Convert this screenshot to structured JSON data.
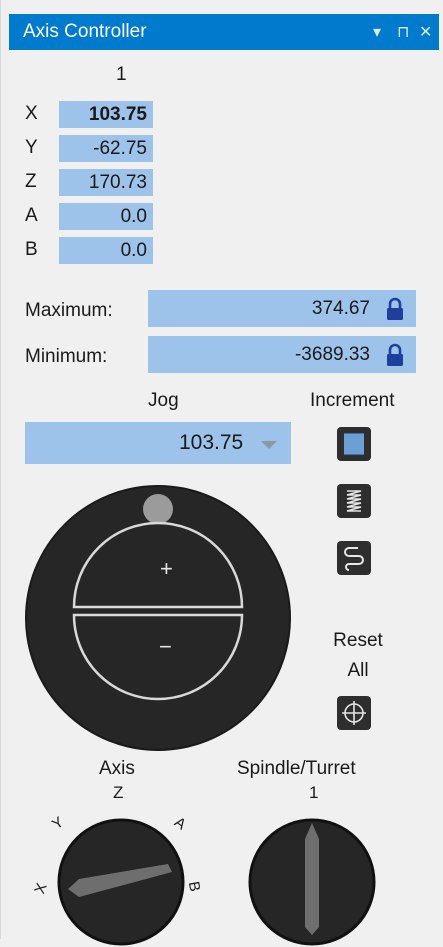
{
  "window": {
    "title": "Axis Controller",
    "controls": [
      "▾",
      "⊓",
      "✕"
    ]
  },
  "positions": {
    "column_header": "1",
    "rows": [
      {
        "axis": "X",
        "value": "103.75"
      },
      {
        "axis": "Y",
        "value": "-62.75"
      },
      {
        "axis": "Z",
        "value": "170.73"
      },
      {
        "axis": "A",
        "value": "0.0"
      },
      {
        "axis": "B",
        "value": "0.0"
      }
    ]
  },
  "limits": {
    "maximum_label": "Maximum:",
    "maximum_value": "374.67",
    "minimum_label": "Minimum:",
    "minimum_value": "-3689.33"
  },
  "jog": {
    "label": "Jog",
    "value": "103.75",
    "plus": "+",
    "minus": "−"
  },
  "increment": {
    "label": "Increment",
    "buttons": [
      "fine-increment-icon",
      "medium-increment-icon",
      "coarse-increment-icon"
    ]
  },
  "reset": {
    "line1": "Reset",
    "line2": "All"
  },
  "axis_selector": {
    "label": "Axis",
    "current": "Z",
    "knob_labels": [
      "X",
      "Y",
      "A",
      "B"
    ]
  },
  "spindle_selector": {
    "label": "Spindle/Turret",
    "current": "1"
  },
  "colors": {
    "title_bar": "#007acc",
    "value_box": "#9ec3ea",
    "knob": "#262626",
    "lock": "#1f3f9c"
  }
}
